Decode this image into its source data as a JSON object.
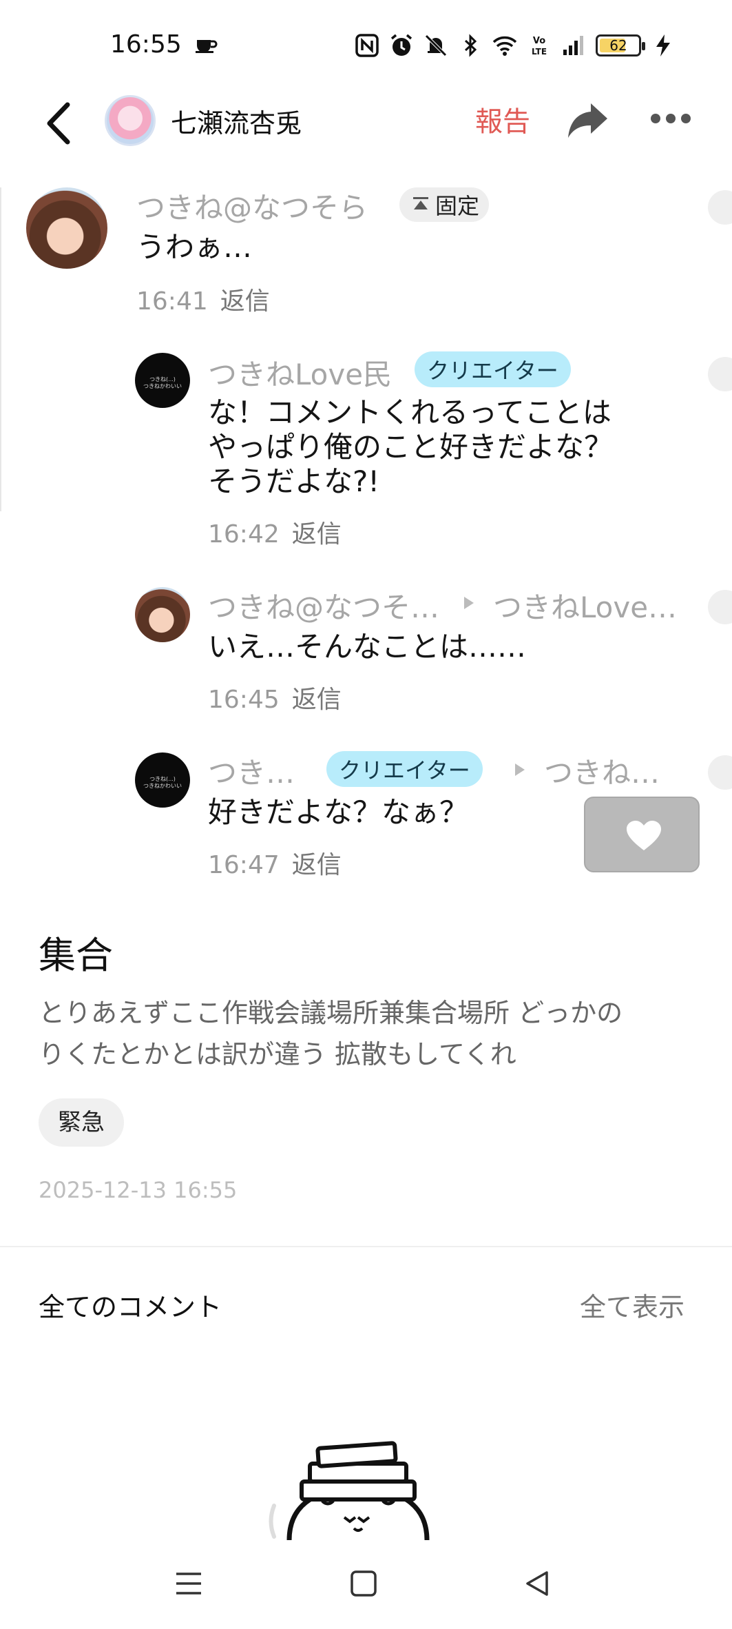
{
  "status_bar": {
    "time": "16:55",
    "battery_level": "62",
    "icons": [
      "coffee-cup-icon",
      "nfc-icon",
      "alarm-icon",
      "silent-bell-icon",
      "bluetooth-icon",
      "wifi-icon",
      "volte-icon",
      "signal-icon",
      "battery-icon",
      "charging-icon"
    ]
  },
  "header": {
    "username": "七瀬流杏兎",
    "report_label": "報告",
    "icons": [
      "back-arrow-icon",
      "avatar",
      "share-icon",
      "more-icon"
    ]
  },
  "comments": [
    {
      "author": "つきね@なつそら",
      "pinned_label": "固定",
      "text": "うわぁ…",
      "time": "16:41",
      "reply_label": "返信"
    },
    {
      "author": "つきねLove民",
      "badge": "クリエイター",
      "lines": [
        "な！コメントくれるってことは",
        "やっぱり俺のこと好きだよな？",
        "そうだよな?!"
      ],
      "time": "16:42",
      "reply_label": "返信"
    },
    {
      "author": "つきね@なつそ…",
      "reply_to": "つきねLove…",
      "text": "いえ…そんなことは……",
      "time": "16:45",
      "reply_label": "返信"
    },
    {
      "author": "つき…",
      "badge": "クリエイター",
      "reply_to": "つきね…",
      "text": "好きだよな？なぁ？",
      "time": "16:47",
      "reply_label": "返信"
    }
  ],
  "post": {
    "title": "集合",
    "body_lines": [
      "とりあえずここ作戦会議場所兼集合場所 どっかの",
      "りくたとかとは訳が違う 拡散もしてくれ"
    ],
    "tag": "緊急",
    "date": "2025-12-13 16:55"
  },
  "comments_section": {
    "title": "全てのコメント",
    "show_all_label": "全て表示"
  },
  "colors": {
    "report_red": "#e05a55",
    "creator_badge_bg": "#b8ecfb",
    "like_button_bg": "#b9b9b9"
  }
}
